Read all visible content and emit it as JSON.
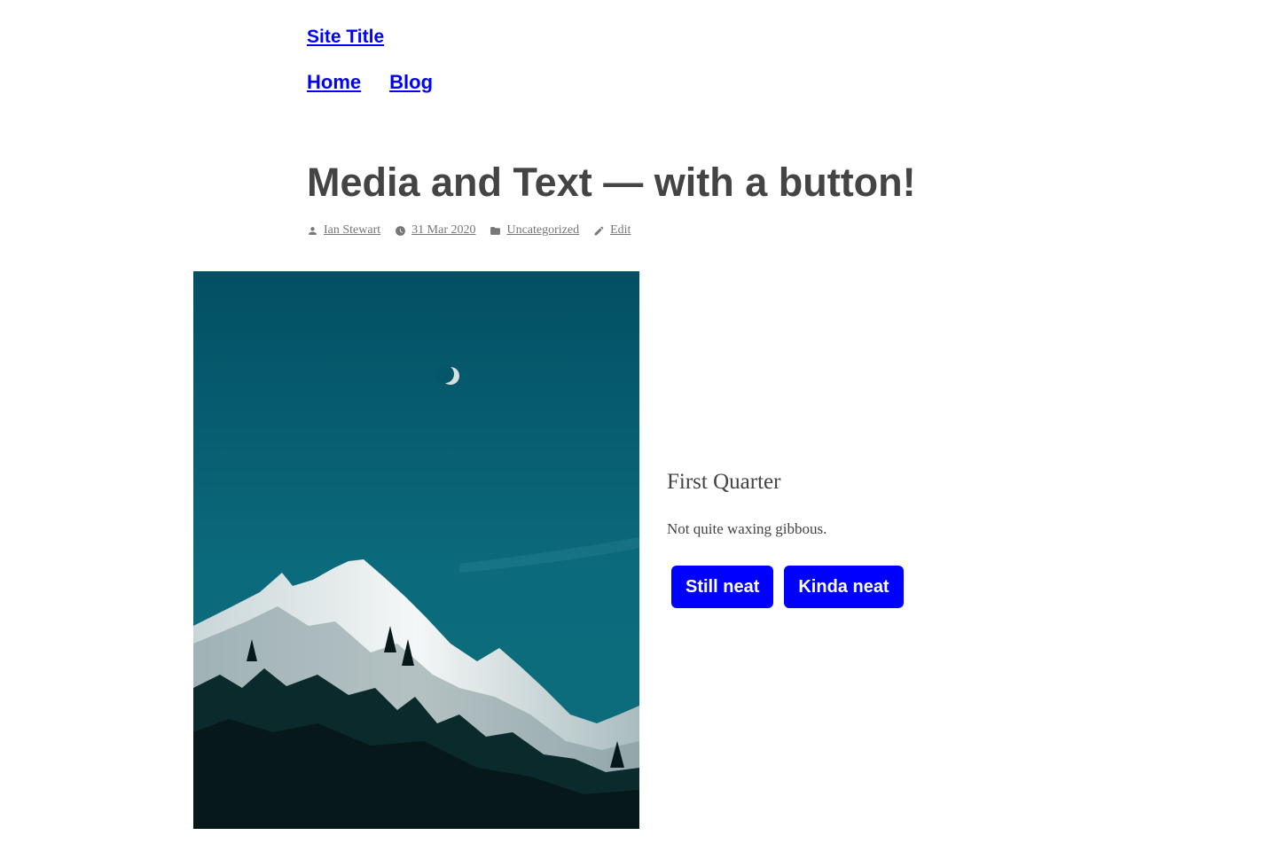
{
  "site": {
    "title": "Site Title"
  },
  "nav": {
    "items": [
      {
        "label": "Home"
      },
      {
        "label": "Blog"
      }
    ]
  },
  "post": {
    "title": "Media and Text — with a button!",
    "meta": {
      "author": "Ian Stewart",
      "date": "31 Mar 2020",
      "category": "Uncategorized",
      "edit": "Edit"
    }
  },
  "media_text": {
    "image_icon": "mountain-moon-photo",
    "heading": "First Quarter",
    "paragraph": "Not quite waxing gibbous.",
    "buttons": [
      {
        "label": "Still neat"
      },
      {
        "label": "Kinda neat"
      }
    ]
  },
  "colors": {
    "link": "#0000ff",
    "text": "#444444",
    "meta": "#767676",
    "button_bg": "#0000ff",
    "button_text": "#ffffff"
  }
}
